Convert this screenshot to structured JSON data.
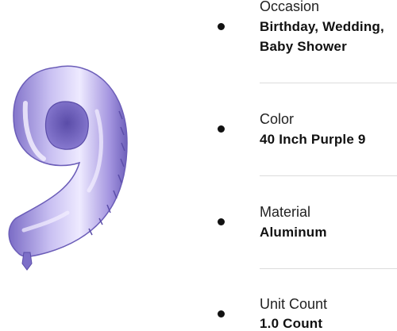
{
  "specs": [
    {
      "label": "Occasion",
      "value_line1": "Birthday, Wedding,",
      "value_line2": "Baby Shower"
    },
    {
      "label": "Color",
      "value_line1": "40 Inch Purple 9"
    },
    {
      "label": "Material",
      "value_line1": "Aluminum"
    },
    {
      "label": "Unit Count",
      "value_line1": "1.0 Count"
    }
  ],
  "balloon": {
    "digit": "9",
    "color": "#a99be0",
    "highlight": "#e8e2fb",
    "shadow": "#6a5cb8"
  }
}
